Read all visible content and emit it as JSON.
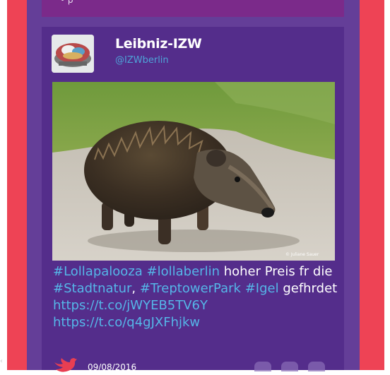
{
  "prev_card": {
    "text": "•  p"
  },
  "card": {
    "name": "Leibniz-IZW",
    "handle": "@IZWberlin",
    "photo_credit": "© Juliane Sauer",
    "tweet": {
      "tag1": "#Lollapalooza",
      "tag2": "#lollaberlin",
      "text1": " hoher Preis fr die ",
      "tag3": "#Stadtnatur",
      "sep1": ", ",
      "tag4": "#TreptowerPark",
      "sep2": " ",
      "tag5": "#Igel",
      "text2": " gefhrdet",
      "url1": "https://t.co/jWYEB5TV6Y",
      "url2": "https://t.co/q4gJXFhjkw"
    },
    "date": "09/08/2016"
  },
  "colors": {
    "red": "#ee4355",
    "panel": "#643e98",
    "card": "#542d8b",
    "link": "#55b6e8"
  }
}
